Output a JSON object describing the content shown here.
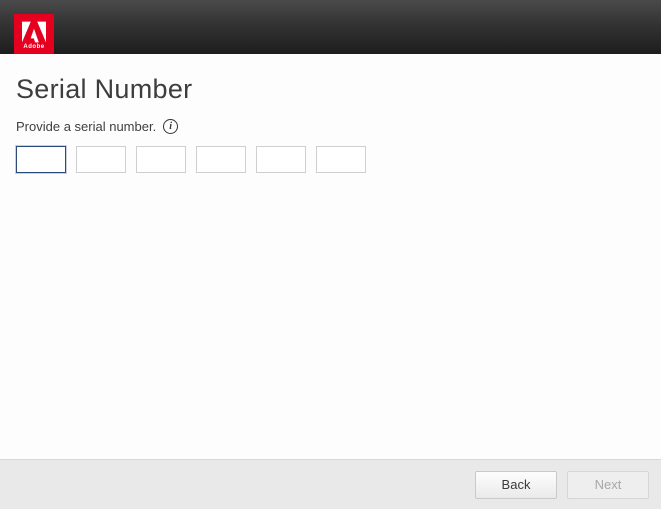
{
  "brand": {
    "name": "Adobe",
    "logo_color": "#e6001f"
  },
  "page": {
    "title": "Serial Number",
    "instruction": "Provide a serial number.",
    "info_icon": "info-icon"
  },
  "serial": {
    "segment_count": 6,
    "focused_index": 0,
    "values": [
      "",
      "",
      "",
      "",
      "",
      ""
    ]
  },
  "footer": {
    "back_label": "Back",
    "next_label": "Next",
    "next_enabled": false
  }
}
